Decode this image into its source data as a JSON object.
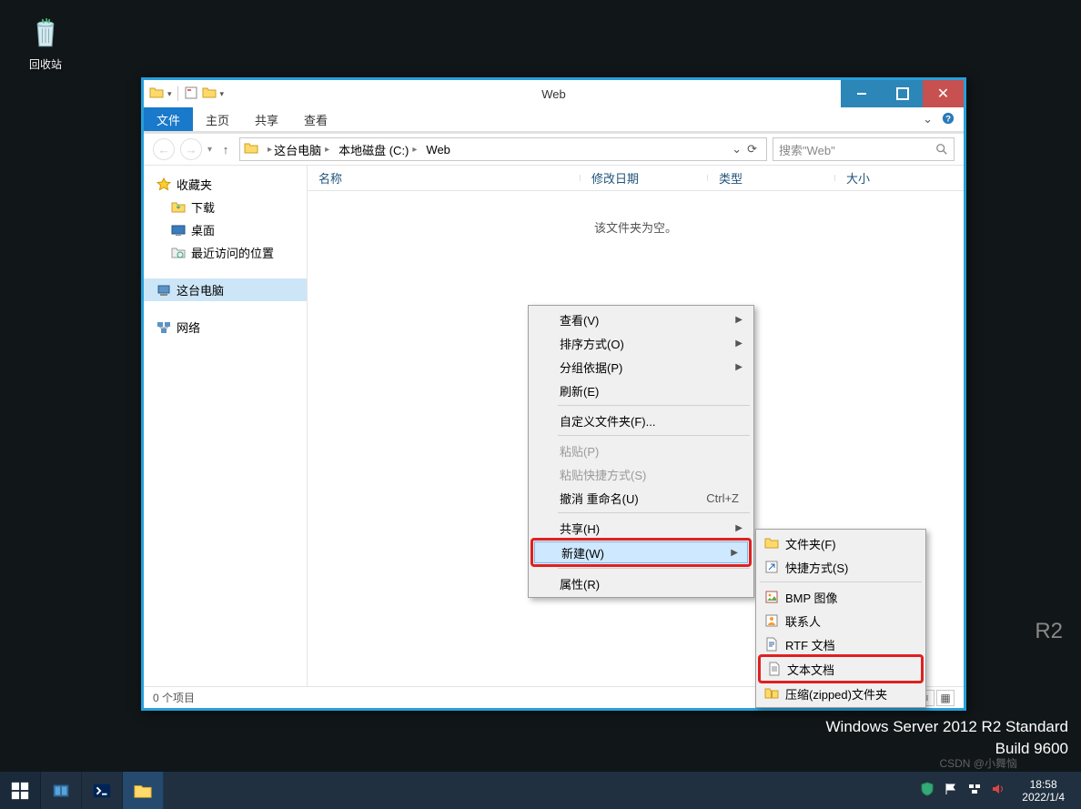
{
  "desktop": {
    "recycle_bin": "回收站"
  },
  "system": {
    "edition": "Windows Server 2012 R2 Standard",
    "build": "Build 9600",
    "ghost": "R2",
    "watermark": "CSDN @小舞恼"
  },
  "taskbar": {
    "clock_time": "18:58",
    "clock_date": "2022/1/4"
  },
  "explorer": {
    "title": "Web",
    "tabs": {
      "file": "文件",
      "home": "主页",
      "share": "共享",
      "view": "查看"
    },
    "breadcrumb": {
      "seg1": "这台电脑",
      "seg2": "本地磁盘 (C:)",
      "seg3": "Web"
    },
    "search_placeholder": "搜索\"Web\"",
    "columns": {
      "name": "名称",
      "modified": "修改日期",
      "type": "类型",
      "size": "大小"
    },
    "empty_text": "该文件夹为空。",
    "status": "0 个项目",
    "sidebar": {
      "favorites": "收藏夹",
      "downloads": "下载",
      "desktop": "桌面",
      "recent": "最近访问的位置",
      "thispc": "这台电脑",
      "network": "网络"
    }
  },
  "context_menu": {
    "view": "查看(V)",
    "sort": "排序方式(O)",
    "group": "分组依据(P)",
    "refresh": "刷新(E)",
    "customize": "自定义文件夹(F)...",
    "paste": "粘贴(P)",
    "paste_shortcut": "粘贴快捷方式(S)",
    "undo": "撤消 重命名(U)",
    "undo_accel": "Ctrl+Z",
    "share": "共享(H)",
    "new": "新建(W)",
    "properties": "属性(R)"
  },
  "submenu": {
    "folder": "文件夹(F)",
    "shortcut": "快捷方式(S)",
    "bmp": "BMP 图像",
    "contact": "联系人",
    "rtf": "RTF 文档",
    "text": "文本文档",
    "zip": "压缩(zipped)文件夹"
  }
}
